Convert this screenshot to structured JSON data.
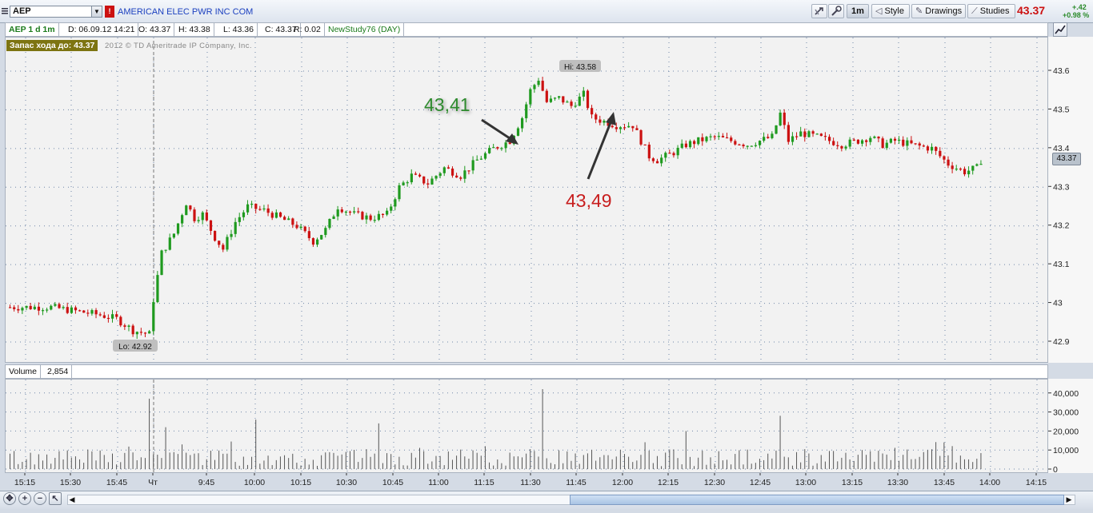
{
  "toolbar": {
    "symbol": "AEP",
    "company": "AMERICAN ELEC PWR INC COM",
    "buttons": {
      "timeframe": "1m",
      "style": "Style",
      "drawings": "Drawings",
      "studies": "Studies"
    },
    "last_price": "43.37",
    "change": "+.42",
    "change_pct": "+0.98 %"
  },
  "info": {
    "symbol_period": "AEP 1 d 1m",
    "date": "D: 06.09.12 14:21",
    "open": "O: 43.37",
    "high": "H: 43.38",
    "low": "L: 43.36",
    "close": "C: 43.37",
    "range": "R: 0.02",
    "study": "NewStudy76 (DAY)"
  },
  "chart": {
    "stop_label": "Запас хода до: 43.37",
    "copyright": "2012 © TD Ameritrade IP Company, Inc.",
    "hi_label": "Hi: 43.58",
    "lo_label": "Lo: 42.92",
    "last_badge": "43.37",
    "annotation_green": "43,41",
    "annotation_red": "43,49",
    "colors": {
      "up": "#1f9a1f",
      "down": "#cc1111",
      "annotation_green": "#2e8b2e",
      "annotation_red": "#c81e1e",
      "arrow": "#333333"
    }
  },
  "volume": {
    "label": "Volume",
    "value": "2,854"
  },
  "price_ticks": [
    "43.6",
    "43.5",
    "43.4",
    "43.3",
    "43.2",
    "43.1",
    "43",
    "42.9"
  ],
  "volume_ticks": [
    "40,000",
    "30,000",
    "20,000",
    "10,000",
    "0"
  ],
  "time_ticks": [
    "15:15",
    "15:30",
    "15:45",
    "Чт",
    "9:45",
    "10:00",
    "10:15",
    "10:30",
    "10:45",
    "11:00",
    "11:15",
    "11:30",
    "11:45",
    "12:00",
    "12:15",
    "12:30",
    "12:45",
    "13:00",
    "13:15",
    "13:30",
    "13:45",
    "14:00",
    "14:15"
  ],
  "chart_data": {
    "type": "candlestick",
    "y_range": [
      42.87,
      43.64
    ],
    "volume_range": [
      0,
      45000
    ],
    "price_path": [
      [
        0,
        42.99
      ],
      [
        10,
        42.99
      ],
      [
        22,
        42.97
      ],
      [
        26,
        42.96
      ],
      [
        30,
        42.93
      ],
      [
        34,
        42.92
      ],
      [
        35,
        43.01
      ],
      [
        37,
        43.13
      ],
      [
        40,
        43.18
      ],
      [
        43,
        43.26
      ],
      [
        45,
        43.22
      ],
      [
        47,
        43.23
      ],
      [
        50,
        43.17
      ],
      [
        52,
        43.14
      ],
      [
        55,
        43.21
      ],
      [
        58,
        43.25
      ],
      [
        62,
        43.24
      ],
      [
        66,
        43.22
      ],
      [
        70,
        43.2
      ],
      [
        72,
        43.18
      ],
      [
        74,
        43.16
      ],
      [
        77,
        43.19
      ],
      [
        80,
        43.25
      ],
      [
        84,
        43.23
      ],
      [
        88,
        43.22
      ],
      [
        92,
        43.23
      ],
      [
        95,
        43.3
      ],
      [
        98,
        43.33
      ],
      [
        102,
        43.31
      ],
      [
        106,
        43.35
      ],
      [
        110,
        43.33
      ],
      [
        114,
        43.37
      ],
      [
        118,
        43.4
      ],
      [
        122,
        43.42
      ],
      [
        125,
        43.48
      ],
      [
        127,
        43.55
      ],
      [
        129,
        43.58
      ],
      [
        131,
        43.52
      ],
      [
        134,
        43.53
      ],
      [
        137,
        43.51
      ],
      [
        140,
        43.54
      ],
      [
        142,
        43.48
      ],
      [
        145,
        43.47
      ],
      [
        148,
        43.46
      ],
      [
        152,
        43.46
      ],
      [
        154,
        43.42
      ],
      [
        156,
        43.38
      ],
      [
        158,
        43.37
      ],
      [
        162,
        43.39
      ],
      [
        165,
        43.41
      ],
      [
        168,
        43.42
      ],
      [
        172,
        43.43
      ],
      [
        176,
        43.42
      ],
      [
        180,
        43.41
      ],
      [
        183,
        43.42
      ],
      [
        186,
        43.43
      ],
      [
        188,
        43.49
      ],
      [
        190,
        43.42
      ],
      [
        193,
        43.44
      ],
      [
        197,
        43.43
      ],
      [
        200,
        43.42
      ],
      [
        203,
        43.41
      ],
      [
        207,
        43.42
      ],
      [
        210,
        43.43
      ],
      [
        213,
        43.41
      ],
      [
        216,
        43.42
      ],
      [
        220,
        43.41
      ],
      [
        225,
        43.4
      ],
      [
        229,
        43.36
      ],
      [
        233,
        43.34
      ],
      [
        236,
        43.35
      ],
      [
        237,
        43.37
      ]
    ],
    "volume_spikes": [
      [
        34,
        37000
      ],
      [
        130,
        42000
      ],
      [
        188,
        28000
      ],
      [
        60,
        26000
      ],
      [
        90,
        24000
      ],
      [
        165,
        20000
      ],
      [
        38,
        22000
      ]
    ]
  }
}
